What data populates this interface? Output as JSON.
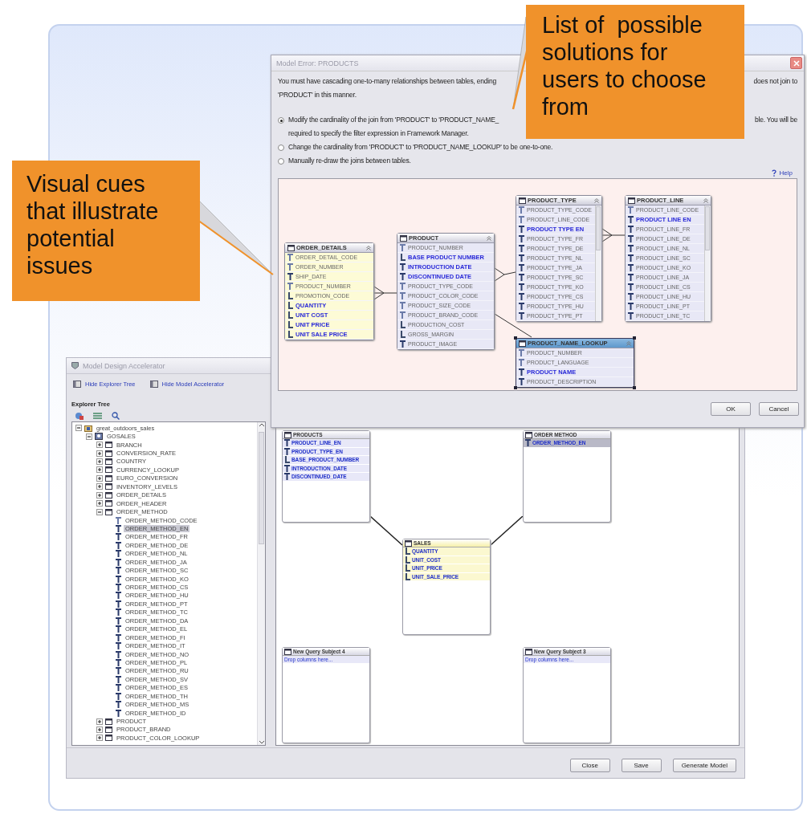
{
  "dialog": {
    "title": "Model Error: PRODUCTS",
    "message": {
      "text_left": "You must have cascading one-to-many relationships between tables, ending",
      "text_right": "does not join to",
      "text_continued": "'PRODUCT' in this manner."
    },
    "options": [
      {
        "label_left": "Modify the cardinality of the join from 'PRODUCT' to 'PRODUCT_NAME_",
        "label_right": "ble. You will be",
        "label_continued": "required to specify the filter expression in Framework Manager.",
        "selected": true
      },
      {
        "label_left": "Change the cardinality from 'PRODUCT' to 'PRODUCT_NAME_LOOKUP' to be one-to-one.",
        "selected": false
      },
      {
        "label_left": "Manually re-draw the joins between tables.",
        "selected": false
      }
    ],
    "help": "Help",
    "diagram": {
      "tables": [
        {
          "name": "ORDER_DETAILS",
          "kind": "fact",
          "selected": false,
          "columns": [
            {
              "label": "ORDER_DETAIL_CODE",
              "kind": "identifier",
              "highlighted": false
            },
            {
              "label": "ORDER_NUMBER",
              "kind": "identifier",
              "highlighted": false
            },
            {
              "label": "SHIP_DATE",
              "kind": "attribute",
              "highlighted": false
            },
            {
              "label": "PRODUCT_NUMBER",
              "kind": "identifier",
              "highlighted": false
            },
            {
              "label": "PROMOTION_CODE",
              "kind": "measure",
              "highlighted": false
            },
            {
              "label": "QUANTITY",
              "kind": "measure",
              "highlighted": true
            },
            {
              "label": "UNIT COST",
              "kind": "measure",
              "highlighted": true
            },
            {
              "label": "UNIT PRICE",
              "kind": "measure",
              "highlighted": true
            },
            {
              "label": "UNIT SALE PRICE",
              "kind": "measure",
              "highlighted": true
            }
          ]
        },
        {
          "name": "PRODUCT",
          "kind": "dimension",
          "selected": false,
          "columns": [
            {
              "label": "PRODUCT_NUMBER",
              "kind": "identifier",
              "highlighted": false
            },
            {
              "label": "BASE PRODUCT NUMBER",
              "kind": "measure",
              "highlighted": true
            },
            {
              "label": "INTRODUCTION DATE",
              "kind": "attribute",
              "highlighted": true
            },
            {
              "label": "DISCONTINUED DATE",
              "kind": "attribute",
              "highlighted": true
            },
            {
              "label": "PRODUCT_TYPE_CODE",
              "kind": "identifier",
              "highlighted": false
            },
            {
              "label": "PRODUCT_COLOR_CODE",
              "kind": "identifier",
              "highlighted": false
            },
            {
              "label": "PRODUCT_SIZE_CODE",
              "kind": "identifier",
              "highlighted": false
            },
            {
              "label": "PRODUCT_BRAND_CODE",
              "kind": "identifier",
              "highlighted": false
            },
            {
              "label": "PRODUCTION_COST",
              "kind": "measure",
              "highlighted": false
            },
            {
              "label": "GROSS_MARGIN",
              "kind": "measure",
              "highlighted": false
            },
            {
              "label": "PRODUCT_IMAGE",
              "kind": "attribute",
              "highlighted": false
            }
          ]
        },
        {
          "name": "PRODUCT_TYPE",
          "kind": "dimension",
          "selected": false,
          "columns": [
            {
              "label": "PRODUCT_TYPE_CODE",
              "kind": "identifier",
              "highlighted": false
            },
            {
              "label": "PRODUCT_LINE_CODE",
              "kind": "identifier",
              "highlighted": false
            },
            {
              "label": "PRODUCT TYPE EN",
              "kind": "attribute",
              "highlighted": true
            },
            {
              "label": "PRODUCT_TYPE_FR",
              "kind": "attribute",
              "highlighted": false
            },
            {
              "label": "PRODUCT_TYPE_DE",
              "kind": "attribute",
              "highlighted": false
            },
            {
              "label": "PRODUCT_TYPE_NL",
              "kind": "attribute",
              "highlighted": false
            },
            {
              "label": "PRODUCT_TYPE_JA",
              "kind": "attribute",
              "highlighted": false
            },
            {
              "label": "PRODUCT_TYPE_SC",
              "kind": "attribute",
              "highlighted": false
            },
            {
              "label": "PRODUCT_TYPE_KO",
              "kind": "attribute",
              "highlighted": false
            },
            {
              "label": "PRODUCT_TYPE_CS",
              "kind": "attribute",
              "highlighted": false
            },
            {
              "label": "PRODUCT_TYPE_HU",
              "kind": "attribute",
              "highlighted": false
            },
            {
              "label": "PRODUCT_TYPE_PT",
              "kind": "attribute",
              "highlighted": false
            }
          ]
        },
        {
          "name": "PRODUCT_LINE",
          "kind": "dimension",
          "selected": false,
          "columns": [
            {
              "label": "PRODUCT_LINE_CODE",
              "kind": "identifier",
              "highlighted": false
            },
            {
              "label": "PRODUCT LINE EN",
              "kind": "attribute",
              "highlighted": true
            },
            {
              "label": "PRODUCT_LINE_FR",
              "kind": "attribute",
              "highlighted": false
            },
            {
              "label": "PRODUCT_LINE_DE",
              "kind": "attribute",
              "highlighted": false
            },
            {
              "label": "PRODUCT_LINE_NL",
              "kind": "attribute",
              "highlighted": false
            },
            {
              "label": "PRODUCT_LINE_SC",
              "kind": "attribute",
              "highlighted": false
            },
            {
              "label": "PRODUCT_LINE_KO",
              "kind": "attribute",
              "highlighted": false
            },
            {
              "label": "PRODUCT_LINE_JA",
              "kind": "attribute",
              "highlighted": false
            },
            {
              "label": "PRODUCT_LINE_CS",
              "kind": "attribute",
              "highlighted": false
            },
            {
              "label": "PRODUCT_LINE_HU",
              "kind": "attribute",
              "highlighted": false
            },
            {
              "label": "PRODUCT_LINE_PT",
              "kind": "attribute",
              "highlighted": false
            },
            {
              "label": "PRODUCT_LINE_TC",
              "kind": "attribute",
              "highlighted": false
            }
          ]
        },
        {
          "name": "PRODUCT_NAME_LOOKUP",
          "kind": "dimension",
          "selected": true,
          "columns": [
            {
              "label": "PRODUCT_NUMBER",
              "kind": "identifier",
              "highlighted": false
            },
            {
              "label": "PRODUCT_LANGUAGE",
              "kind": "identifier",
              "highlighted": false
            },
            {
              "label": "PRODUCT NAME",
              "kind": "attribute",
              "highlighted": true
            },
            {
              "label": "PRODUCT_DESCRIPTION",
              "kind": "attribute",
              "highlighted": false
            }
          ]
        }
      ]
    },
    "buttons": [
      "OK",
      "Cancel"
    ]
  },
  "main_window": {
    "title": "Model Design Accelerator",
    "toolbar": [
      {
        "label": "Hide Explorer Tree"
      },
      {
        "label": "Hide Model Accelerator"
      }
    ],
    "explorer": {
      "title": "Explorer Tree",
      "tree": [
        {
          "label": "great_outdoors_sales",
          "kind": "package",
          "expanded": true,
          "selected": false,
          "children": [
            {
              "label": "GOSALES",
              "kind": "namespace",
              "expanded": true,
              "selected": false,
              "children": [
                {
                  "label": "BRANCH",
                  "kind": "table",
                  "expanded": false,
                  "selected": false
                },
                {
                  "label": "CONVERSION_RATE",
                  "kind": "table",
                  "expanded": false,
                  "selected": false
                },
                {
                  "label": "COUNTRY",
                  "kind": "table",
                  "expanded": false,
                  "selected": false
                },
                {
                  "label": "CURRENCY_LOOKUP",
                  "kind": "table",
                  "expanded": false,
                  "selected": false
                },
                {
                  "label": "EURO_CONVERSION",
                  "kind": "table",
                  "expanded": false,
                  "selected": false
                },
                {
                  "label": "INVENTORY_LEVELS",
                  "kind": "table",
                  "expanded": false,
                  "selected": false
                },
                {
                  "label": "ORDER_DETAILS",
                  "kind": "table",
                  "expanded": false,
                  "selected": false
                },
                {
                  "label": "ORDER_HEADER",
                  "kind": "table",
                  "expanded": false,
                  "selected": false
                },
                {
                  "label": "ORDER_METHOD",
                  "kind": "table",
                  "expanded": true,
                  "selected": false,
                  "children": [
                    {
                      "label": "ORDER_METHOD_CODE",
                      "kind": "key",
                      "selected": false
                    },
                    {
                      "label": "ORDER_METHOD_EN",
                      "kind": "column",
                      "selected": true
                    },
                    {
                      "label": "ORDER_METHOD_FR",
                      "kind": "column",
                      "selected": false
                    },
                    {
                      "label": "ORDER_METHOD_DE",
                      "kind": "column",
                      "selected": false
                    },
                    {
                      "label": "ORDER_METHOD_NL",
                      "kind": "column",
                      "selected": false
                    },
                    {
                      "label": "ORDER_METHOD_JA",
                      "kind": "column",
                      "selected": false
                    },
                    {
                      "label": "ORDER_METHOD_SC",
                      "kind": "column",
                      "selected": false
                    },
                    {
                      "label": "ORDER_METHOD_KO",
                      "kind": "column",
                      "selected": false
                    },
                    {
                      "label": "ORDER_METHOD_CS",
                      "kind": "column",
                      "selected": false
                    },
                    {
                      "label": "ORDER_METHOD_HU",
                      "kind": "column",
                      "selected": false
                    },
                    {
                      "label": "ORDER_METHOD_PT",
                      "kind": "column",
                      "selected": false
                    },
                    {
                      "label": "ORDER_METHOD_TC",
                      "kind": "column",
                      "selected": false
                    },
                    {
                      "label": "ORDER_METHOD_DA",
                      "kind": "column",
                      "selected": false
                    },
                    {
                      "label": "ORDER_METHOD_EL",
                      "kind": "column",
                      "selected": false
                    },
                    {
                      "label": "ORDER_METHOD_FI",
                      "kind": "column",
                      "selected": false
                    },
                    {
                      "label": "ORDER_METHOD_IT",
                      "kind": "column",
                      "selected": false
                    },
                    {
                      "label": "ORDER_METHOD_NO",
                      "kind": "column",
                      "selected": false
                    },
                    {
                      "label": "ORDER_METHOD_PL",
                      "kind": "column",
                      "selected": false
                    },
                    {
                      "label": "ORDER_METHOD_RU",
                      "kind": "column",
                      "selected": false
                    },
                    {
                      "label": "ORDER_METHOD_SV",
                      "kind": "column",
                      "selected": false
                    },
                    {
                      "label": "ORDER_METHOD_ES",
                      "kind": "column",
                      "selected": false
                    },
                    {
                      "label": "ORDER_METHOD_TH",
                      "kind": "column",
                      "selected": false
                    },
                    {
                      "label": "ORDER_METHOD_MS",
                      "kind": "column",
                      "selected": false
                    },
                    {
                      "label": "ORDER_METHOD_ID",
                      "kind": "column",
                      "selected": false
                    }
                  ]
                },
                {
                  "label": "PRODUCT",
                  "kind": "table",
                  "expanded": false,
                  "selected": false
                },
                {
                  "label": "PRODUCT_BRAND",
                  "kind": "table",
                  "expanded": false,
                  "selected": false
                },
                {
                  "label": "PRODUCT_COLOR_LOOKUP",
                  "kind": "table",
                  "expanded": false,
                  "selected": false
                }
              ]
            }
          ]
        }
      ]
    },
    "canvas": {
      "query_subjects": [
        {
          "name": "PRODUCTS",
          "kind": "dimension",
          "columns": [
            {
              "label": "PRODUCT_LINE_EN",
              "kind": "attribute",
              "selected": false
            },
            {
              "label": "PRODUCT_TYPE_EN",
              "kind": "attribute",
              "selected": false
            },
            {
              "label": "BASE_PRODUCT_NUMBER",
              "kind": "measure",
              "selected": false
            },
            {
              "label": "INTRODUCTION_DATE",
              "kind": "attribute",
              "selected": false
            },
            {
              "label": "DISCONTINUED_DATE",
              "kind": "attribute",
              "selected": false
            }
          ]
        },
        {
          "name": "ORDER METHOD",
          "kind": "dimension",
          "columns": [
            {
              "label": "ORDER_METHOD_EN",
              "kind": "attribute",
              "selected": true
            }
          ]
        },
        {
          "name": "SALES",
          "kind": "fact",
          "columns": [
            {
              "label": "QUANTITY",
              "kind": "measure",
              "selected": false
            },
            {
              "label": "UNIT_COST",
              "kind": "measure",
              "selected": false
            },
            {
              "label": "UNIT_PRICE",
              "kind": "measure",
              "selected": false
            },
            {
              "label": "UNIT_SALE_PRICE",
              "kind": "measure",
              "selected": false
            }
          ]
        },
        {
          "name": "New Query Subject 4",
          "kind": "empty",
          "hint": "Drop columns here..."
        },
        {
          "name": "New Query Subject 3",
          "kind": "empty",
          "hint": "Drop columns here..."
        }
      ]
    },
    "buttons": [
      "Close",
      "Save",
      "Generate Model"
    ]
  },
  "callouts": [
    {
      "text": "List of  possible solutions for users to choose from"
    },
    {
      "text": "Visual cues that illustrate potential issues"
    }
  ]
}
